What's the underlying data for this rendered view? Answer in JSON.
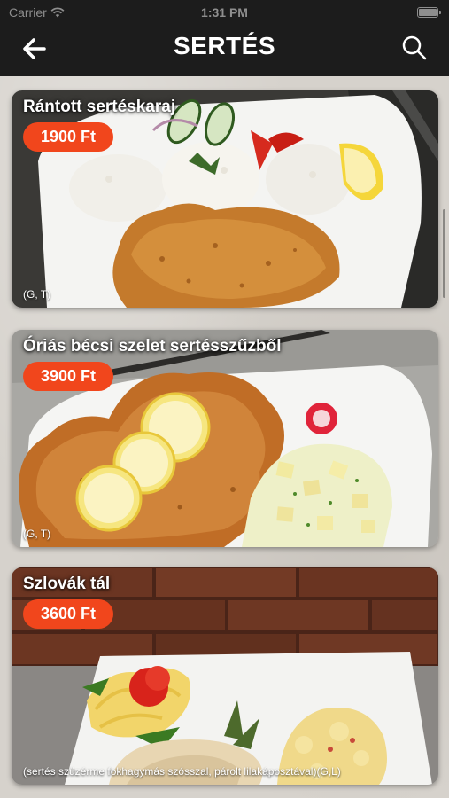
{
  "status": {
    "carrier": "Carrier",
    "time": "1:31 PM"
  },
  "nav": {
    "title": "SERTÉS",
    "back_icon": "arrow-left-icon",
    "search_icon": "search-icon"
  },
  "colors": {
    "bar_bg": "#1c1c1c",
    "price_badge": "#f1461c",
    "text_light": "#ffffff"
  },
  "dishes": [
    {
      "name": "Rántott sertéskaraj",
      "price": "1900 Ft",
      "allergens": "(G, T)"
    },
    {
      "name": "Óriás bécsi szelet sertésszűzből",
      "price": "3900 Ft",
      "allergens": "(G, T)"
    },
    {
      "name": "Szlovák tál",
      "price": "3600 Ft",
      "allergens": "(sertés szüzérme fokhagymás szósszal, párolt lilakáposztával)(G,L)"
    }
  ]
}
